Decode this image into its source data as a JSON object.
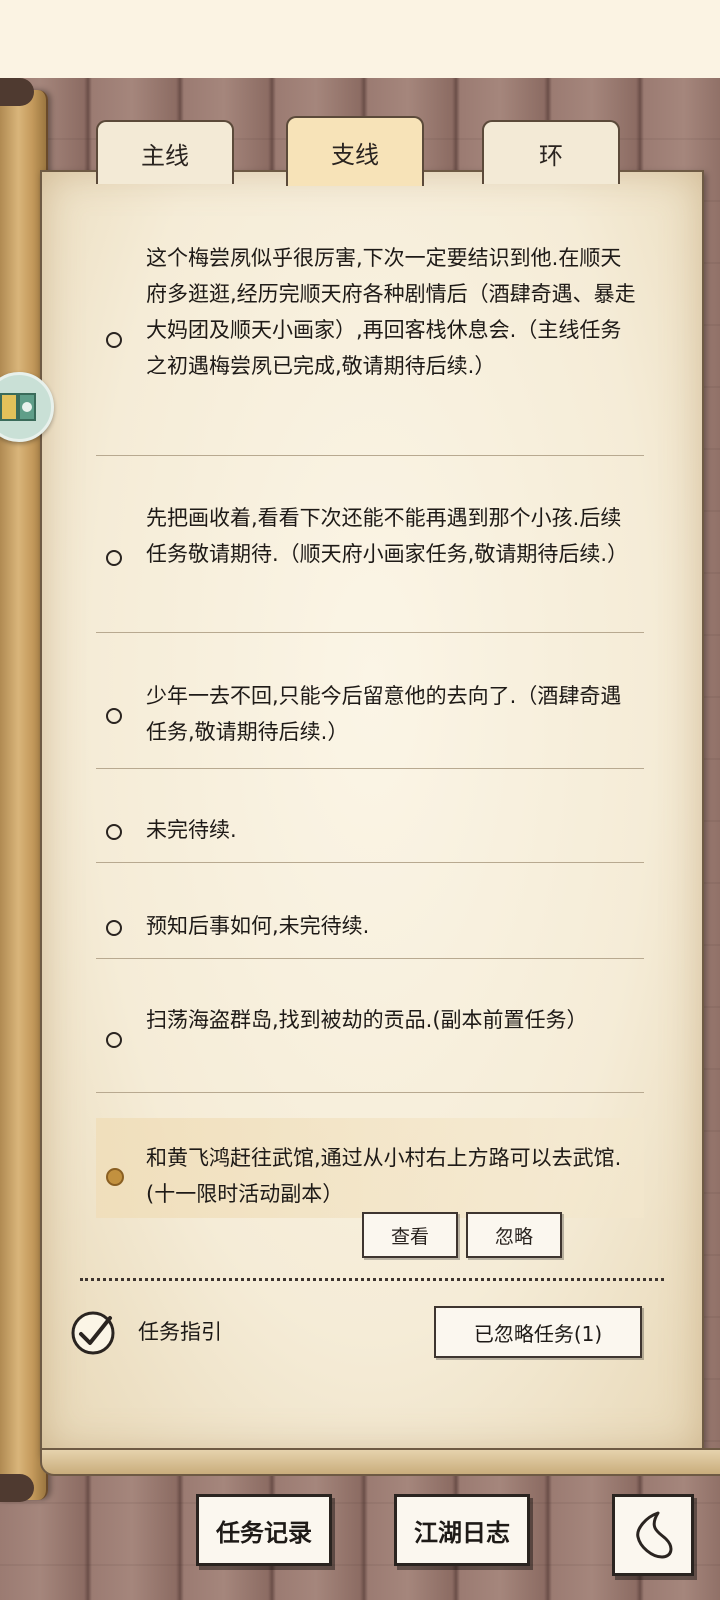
{
  "tabs": [
    {
      "label": "主线",
      "active": false
    },
    {
      "label": "支线",
      "active": true
    },
    {
      "label": "环",
      "active": false
    }
  ],
  "tasks": [
    {
      "text": "这个梅尝夙似乎很厉害,下次一定要结识到他.在顺天府多逛逛,经历完顺天府各种剧情后（酒肆奇遇、暴走大妈团及顺天小画家）,再回客栈休息会.（主线任务之初遇梅尝夙已完成,敬请期待后续.）"
    },
    {
      "text": "先把画收着,看看下次还能不能再遇到那个小孩.后续任务敬请期待.（顺天府小画家任务,敬请期待后续.）"
    },
    {
      "text": "少年一去不回,只能今后留意他的去向了.（酒肆奇遇任务,敬请期待后续.）"
    },
    {
      "text": "未完待续."
    },
    {
      "text": "预知后事如何,未完待续."
    },
    {
      "text": "扫荡海盗群岛,找到被劫的贡品.(副本前置任务）"
    },
    {
      "text": "和黄飞鸿赶往武馆,通过从小村右上方路可以去武馆.(十一限时活动副本）"
    }
  ],
  "selected_task_actions": {
    "view": "查看",
    "ignore": "忽略"
  },
  "footer": {
    "guide_label": "任务指引",
    "guide_checked": true,
    "ignored_button": "已忽略任务(1)"
  },
  "bottom_nav": {
    "task_record": "任务记录",
    "jianghu_log": "江湖日志"
  },
  "colors": {
    "paper": "#f5ecd7",
    "accent_dot": "#c2913f",
    "wood": "#9b7b72"
  },
  "icons": {
    "back": "back-arrow-icon",
    "guide": "checkmark-circle-icon"
  }
}
